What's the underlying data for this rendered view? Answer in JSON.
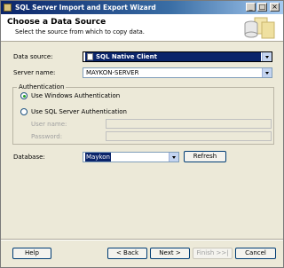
{
  "window": {
    "title": "SQL Server Import and Export Wizard",
    "controls": {
      "minimize": "_",
      "maximize": "□",
      "close": "×"
    }
  },
  "header": {
    "title": "Choose a Data Source",
    "subtitle": "Select the source from which to copy data."
  },
  "form": {
    "data_source_label": "Data source:",
    "data_source_value": "SQL Native Client",
    "server_name_label": "Server name:",
    "server_name_value": "MAYKON-SERVER",
    "auth_group_label": "Authentication",
    "windows_auth_label": "Use Windows Authentication",
    "sql_auth_label": "Use SQL Server Authentication",
    "selected_auth": "windows",
    "user_name_label": "User name:",
    "user_name_value": "",
    "password_label": "Password:",
    "password_value": "",
    "database_label": "Database:",
    "database_value": "Maykon",
    "refresh_label": "Refresh"
  },
  "footer": {
    "help": "Help",
    "back": "< Back",
    "next": "Next >",
    "finish": "Finish >>|",
    "cancel": "Cancel"
  },
  "colors": {
    "title_bar": "#0a246a",
    "dialog_bg": "#ece9d8",
    "selection": "#0a246a"
  },
  "icons": [
    "app-icon",
    "database-wizard-icon",
    "data-source-icon",
    "chevron-down-icon"
  ]
}
